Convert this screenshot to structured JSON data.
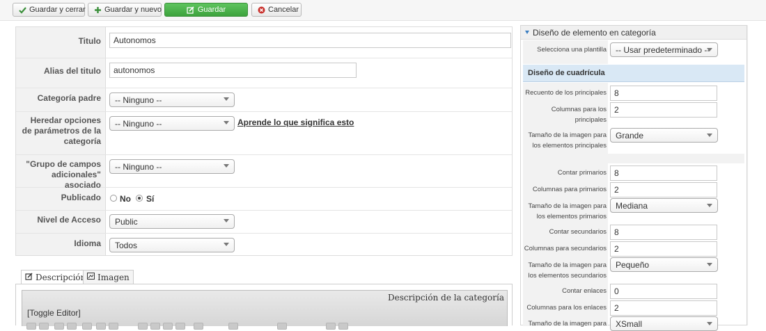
{
  "toolbar": {
    "save_close_label": "Guardar y cerrar",
    "save_new_label": "Guardar y nuevo",
    "save_label": "Guardar",
    "cancel_label": "Cancelar"
  },
  "form": {
    "title_label": "Titulo",
    "title_value": "Autonomos",
    "alias_label": "Alias del titulo",
    "alias_value": "autonomos",
    "parent_label": "Categoría padre",
    "parent_value": "-- Ninguno --",
    "inherit_label": "Heredar opciones de parámetros de la categoría",
    "inherit_value": "-- Ninguno --",
    "inherit_help": "Aprende lo que significa esto",
    "extra_fields_label": "\"Grupo de campos adicionales\" asociado",
    "extra_fields_value": "-- Ninguno --",
    "published_label": "Publicado",
    "published_no": "No",
    "published_yes": "Sí",
    "access_label": "Nivel de Acceso",
    "access_value": "Public",
    "language_label": "Idioma",
    "language_value": "Todos"
  },
  "tabs": {
    "description": "Descripción",
    "image": "Imagen"
  },
  "editor": {
    "title": "Descripción de la categoría",
    "toggle": "[Toggle Editor]"
  },
  "right_panel": {
    "header": "Diseño de elemento en categoría",
    "template_label": "Selecciona una plantilla",
    "template_value": "-- Usar predeterminado --",
    "grid_header": "Diseño de cuadrícula",
    "rows": [
      {
        "label": "Recuento de los principales",
        "value": "8"
      },
      {
        "label": "Columnas para los principales",
        "value": "2"
      },
      {
        "label": "Tamaño de la imagen para los elementos principales",
        "value": "Grande"
      },
      {
        "label": "Contar primarios",
        "value": "8"
      },
      {
        "label": "Columnas para primarios",
        "value": "2"
      },
      {
        "label": "Tamaño de la imagen para los elementos primarios",
        "value": "Mediana"
      },
      {
        "label": "Contar secundarios",
        "value": "8"
      },
      {
        "label": "Columnas para secundarios",
        "value": "2"
      },
      {
        "label": "Tamaño de la imagen para los elementos secundarios",
        "value": "Pequeño"
      },
      {
        "label": "Contar enlaces",
        "value": "0"
      },
      {
        "label": "Columnas para los enlaces",
        "value": "2"
      },
      {
        "label": "Tamaño de la imagen para",
        "value": "XSmall"
      }
    ]
  },
  "colors": {
    "save_green": "#3da33d",
    "grid_header_bg": "#d9e8f5",
    "header_triangle": "#3a7ec1"
  }
}
